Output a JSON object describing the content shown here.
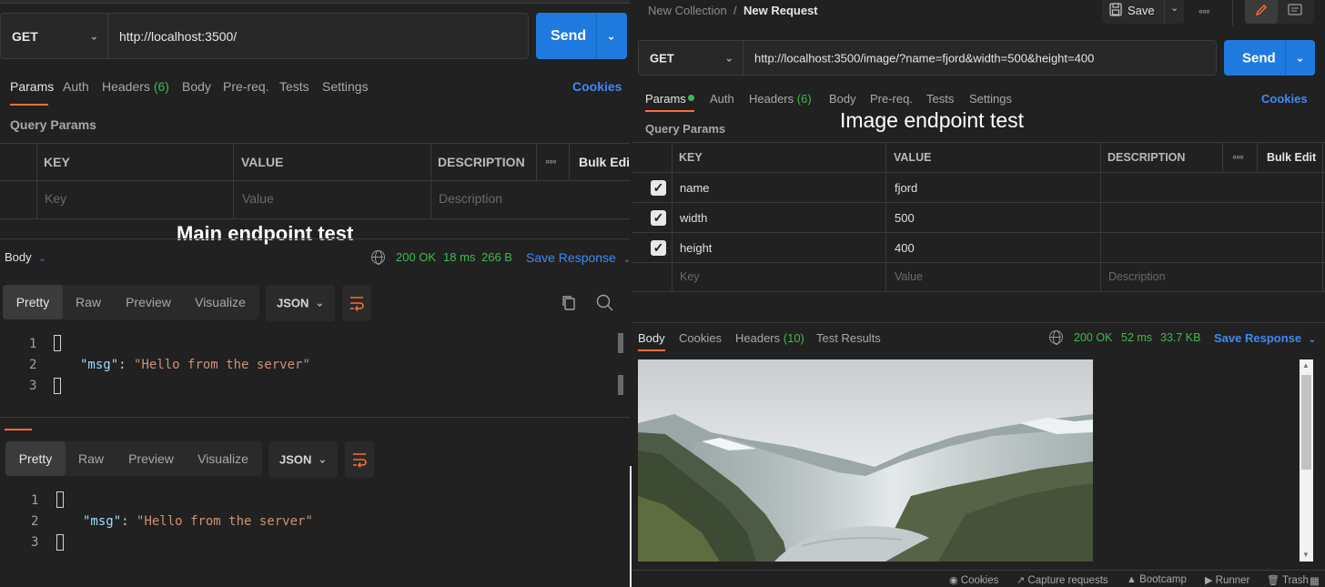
{
  "left": {
    "request": {
      "method": "GET",
      "url": "http://localhost:3500/",
      "send_label": "Send"
    },
    "tabs": [
      {
        "label": "Params",
        "active": true
      },
      {
        "label": "Auth"
      },
      {
        "label": "Headers",
        "count": "(6)"
      },
      {
        "label": "Body"
      },
      {
        "label": "Pre-req."
      },
      {
        "label": "Tests"
      },
      {
        "label": "Settings"
      }
    ],
    "cookies_label": "Cookies",
    "query_params_title": "Query Params",
    "table": {
      "headers": [
        "KEY",
        "VALUE",
        "DESCRIPTION"
      ],
      "bulk_edit": "Bulk Edit",
      "placeholders": [
        "Key",
        "Value",
        "Description"
      ]
    },
    "caption": "Main endpoint test",
    "response": {
      "section_label": "Body",
      "status": "200 OK",
      "time": "18 ms",
      "size": "266 B",
      "save_label": "Save Response"
    },
    "views": [
      "Pretty",
      "Raw",
      "Preview",
      "Visualize"
    ],
    "format": "JSON",
    "code": {
      "line_numbers": [
        "1",
        "2",
        "3"
      ],
      "key": "\"msg\"",
      "colon": ": ",
      "value": "\"Hello from the server\""
    }
  },
  "right": {
    "breadcrumb": {
      "collection": "New Collection",
      "separator": "/",
      "request": "New Request"
    },
    "save_label": "Save",
    "request": {
      "method": "GET",
      "url": "http://localhost:3500/image/?name=fjord&width=500&height=400",
      "send_label": "Send"
    },
    "tabs": [
      {
        "label": "Params",
        "active": true
      },
      {
        "label": "Auth"
      },
      {
        "label": "Headers",
        "count": "(6)"
      },
      {
        "label": "Body"
      },
      {
        "label": "Pre-req."
      },
      {
        "label": "Tests"
      },
      {
        "label": "Settings"
      }
    ],
    "cookies_label": "Cookies",
    "query_params_title": "Query Params",
    "caption": "Image endpoint test",
    "table": {
      "headers": [
        "KEY",
        "VALUE",
        "DESCRIPTION"
      ],
      "bulk_edit": "Bulk Edit",
      "rows": [
        {
          "checked": true,
          "key": "name",
          "value": "fjord"
        },
        {
          "checked": true,
          "key": "width",
          "value": "500"
        },
        {
          "checked": true,
          "key": "height",
          "value": "400"
        }
      ],
      "placeholders": [
        "Key",
        "Value",
        "Description"
      ]
    },
    "response": {
      "tabs": [
        {
          "label": "Body",
          "active": true
        },
        {
          "label": "Cookies"
        },
        {
          "label": "Headers",
          "count": "(10)"
        },
        {
          "label": "Test Results"
        }
      ],
      "status": "200 OK",
      "time": "52 ms",
      "size": "33.7 KB",
      "save_label": "Save Response"
    },
    "footer": [
      "Cookies",
      "Capture requests",
      "Bootcamp",
      "Runner",
      "Trash"
    ]
  },
  "colors": {
    "background": "#212121",
    "accent_orange": "#ff6c37",
    "send_blue": "#1f7ae0",
    "link_blue": "#3d8af7",
    "status_green": "#3fb950"
  }
}
